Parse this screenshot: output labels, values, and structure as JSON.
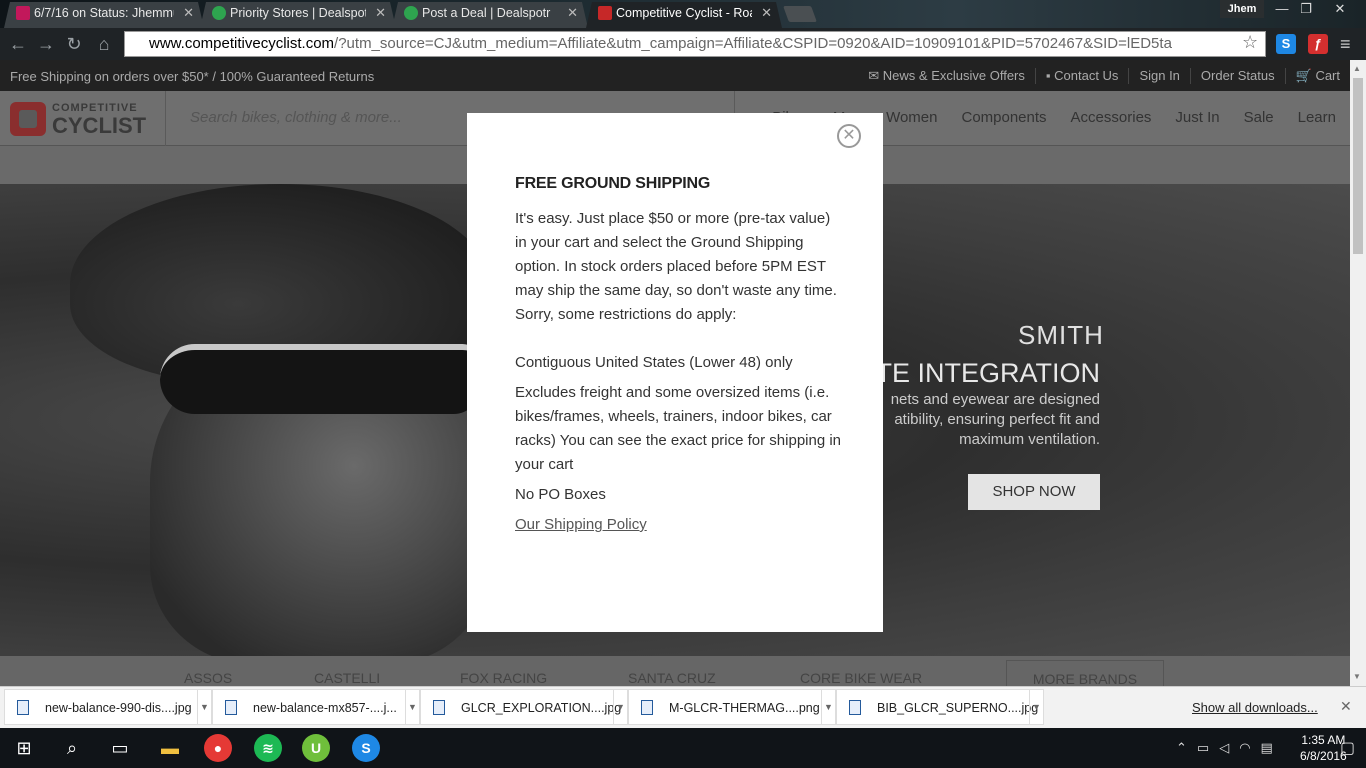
{
  "browser": {
    "tabs": [
      {
        "title": "6/7/16 on Status: Jhemmu",
        "favicon_color": "#c2185b"
      },
      {
        "title": "Priority Stores | Dealspotr",
        "favicon_color": "#2ea44f"
      },
      {
        "title": "Post a Deal | Dealspotr",
        "favicon_color": "#2ea44f"
      },
      {
        "title": "Competitive Cyclist - Roa",
        "favicon_color": "#c62828"
      }
    ],
    "profile_name": "Jhem",
    "url_host": "www.competitivecyclist.com",
    "url_rest": "/?utm_source=CJ&utm_medium=Affiliate&utm_campaign=Affiliate&CSPID=0920&AID=10909101&PID=5702467&SID=lED5ta",
    "extensions": [
      {
        "label": "S",
        "color": "#1e88e5"
      },
      {
        "label": "ƒ",
        "color": "#d32f2f"
      }
    ]
  },
  "site": {
    "util_left": "Free Shipping on orders over $50*  /  100% Guaranteed Returns",
    "util_links": [
      "News & Exclusive Offers",
      "Contact Us",
      "Sign In",
      "Order Status",
      "Cart"
    ],
    "logo_line1": "COMPETITIVE",
    "logo_line2": "CYCLIST",
    "search_placeholder": "Search bikes, clothing & more...",
    "nav": [
      "Bikes",
      "Men",
      "Women",
      "Components",
      "Accessories",
      "Just In",
      "Sale",
      "Learn"
    ],
    "hero_brand": "SMITH",
    "hero_title": "ATE INTEGRATION",
    "hero_copy": "nets and eyewear are designed atibility, ensuring perfect fit and maximum ventilation.",
    "hero_cta": "SHOP NOW",
    "brands": [
      "ASSOS",
      "CASTELLI",
      "FOX RACING",
      "SANTA CRUZ",
      "CORE BIKE WEAR"
    ],
    "more_brands": "MORE BRANDS"
  },
  "modal": {
    "title": "FREE GROUND SHIPPING",
    "intro": "It's easy. Just place $50 or more (pre-tax value) in your cart and select the Ground Shipping option. In stock orders placed before 5PM EST may ship the same day, so don't waste any time. Sorry, some restrictions do apply:",
    "restriction_1": "Contiguous United States (Lower 48) only",
    "restriction_2": "Excludes freight and some oversized items (i.e. bikes/frames, wheels, trainers, indoor bikes, car racks) You can see the exact price for shipping in your cart",
    "restriction_3": "No PO Boxes",
    "policy_link": "Our Shipping Policy"
  },
  "downloads": {
    "items": [
      "new-balance-990-dis....jpg",
      "new-balance-mx857-....j...",
      "GLCR_EXPLORATION....jpg",
      "M-GLCR-THERMAG....png",
      "BIB_GLCR_SUPERNO....jpg"
    ],
    "show_all": "Show all downloads..."
  },
  "taskbar": {
    "time": "1:35 AM",
    "date": "6/8/2016"
  }
}
